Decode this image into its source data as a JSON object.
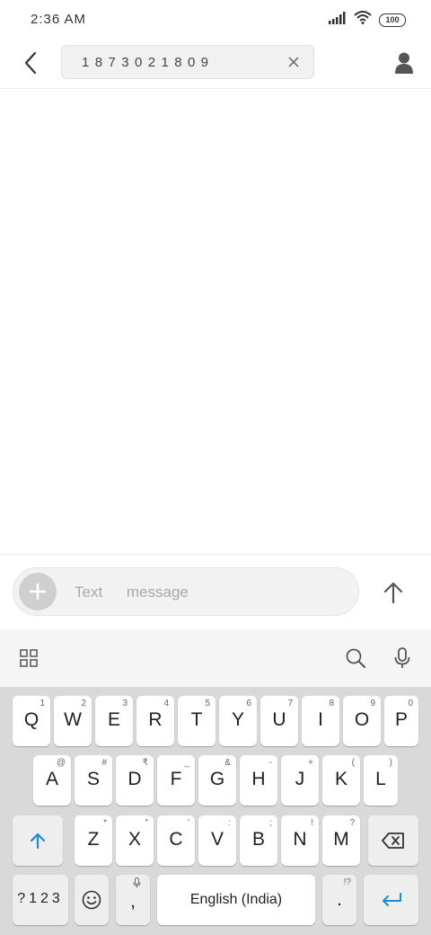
{
  "status_bar": {
    "time": "2:36  AM",
    "battery": "100"
  },
  "header": {
    "recipient_number": "1873021809"
  },
  "compose": {
    "placeholder": "Text message"
  },
  "keyboard": {
    "row1": [
      {
        "key": "Q",
        "hint": "1"
      },
      {
        "key": "W",
        "hint": "2"
      },
      {
        "key": "E",
        "hint": "3"
      },
      {
        "key": "R",
        "hint": "4"
      },
      {
        "key": "T",
        "hint": "5"
      },
      {
        "key": "Y",
        "hint": "6"
      },
      {
        "key": "U",
        "hint": "7"
      },
      {
        "key": "I",
        "hint": "8"
      },
      {
        "key": "O",
        "hint": "9"
      },
      {
        "key": "P",
        "hint": "0"
      }
    ],
    "row2": [
      {
        "key": "A",
        "hint": "@"
      },
      {
        "key": "S",
        "hint": "#"
      },
      {
        "key": "D",
        "hint": "₹"
      },
      {
        "key": "F",
        "hint": "_"
      },
      {
        "key": "G",
        "hint": "&"
      },
      {
        "key": "H",
        "hint": "-"
      },
      {
        "key": "J",
        "hint": "+"
      },
      {
        "key": "K",
        "hint": "("
      },
      {
        "key": "L",
        "hint": ")"
      }
    ],
    "row3": [
      {
        "key": "Z",
        "hint": "*"
      },
      {
        "key": "X",
        "hint": "\""
      },
      {
        "key": "C",
        "hint": "'"
      },
      {
        "key": "V",
        "hint": ":"
      },
      {
        "key": "B",
        "hint": ";"
      },
      {
        "key": "N",
        "hint": "!"
      },
      {
        "key": "M",
        "hint": "?"
      }
    ],
    "symbols_label": "?123",
    "comma_label": ",",
    "space_label": "English (India)",
    "period_label": ".",
    "period_hint": "!?"
  },
  "colors": {
    "accent": "#1a8ad4"
  }
}
